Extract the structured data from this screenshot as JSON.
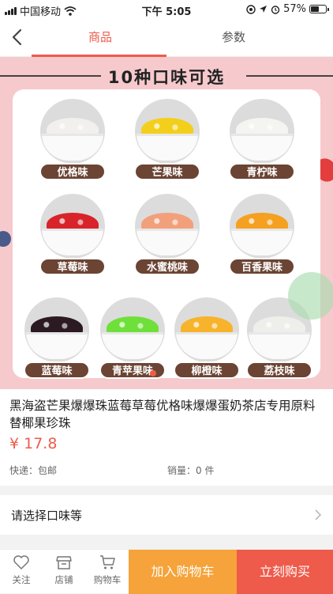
{
  "status_bar": {
    "carrier": "中国移动",
    "time": "下午 5:05",
    "battery": "57%",
    "battery_level": 0.57,
    "icons": [
      "signal-icon",
      "wifi-icon",
      "location-icon",
      "alarm-icon",
      "battery-icon"
    ]
  },
  "nav": {
    "tabs": [
      {
        "label": "商品",
        "active": true
      },
      {
        "label": "参数",
        "active": false
      }
    ],
    "active_color": "#ee5b4b"
  },
  "hero": {
    "title": "10种口味可选",
    "background": "#f6c9cd",
    "flavors": [
      {
        "label": "优格味",
        "bead_color": "#f1f0ec"
      },
      {
        "label": "芒果味",
        "bead_color": "#f3cf1c"
      },
      {
        "label": "青柠味",
        "bead_color": "#f4f4f0"
      },
      {
        "label": "草莓味",
        "bead_color": "#d8232a"
      },
      {
        "label": "水蜜桃味",
        "bead_color": "#f2a07b"
      },
      {
        "label": "百香果味",
        "bead_color": "#f5a020"
      },
      {
        "label": "蓝莓味",
        "bead_color": "#2b1a22"
      },
      {
        "label": "青苹果味",
        "bead_color": "#6fe03a"
      },
      {
        "label": "柳橙味",
        "bead_color": "#f7b32b"
      },
      {
        "label": "荔枝味",
        "bead_color": "#eeeeea"
      }
    ]
  },
  "product": {
    "title": "黑海盗芒果爆爆珠蓝莓草莓优格味爆爆蛋奶茶店专用原料替椰果珍珠",
    "price": "¥ 17.8",
    "shipping": "快递：包邮",
    "sales": "销量：0 件"
  },
  "options": {
    "label": "请选择口味等"
  },
  "bottom_bar": {
    "follow": "关注",
    "store": "店铺",
    "cart": "购物车",
    "add_to_cart": "加入购物车",
    "buy_now": "立刻购买",
    "cart_color": "#f5a33a",
    "buy_color": "#ee5b4b"
  }
}
